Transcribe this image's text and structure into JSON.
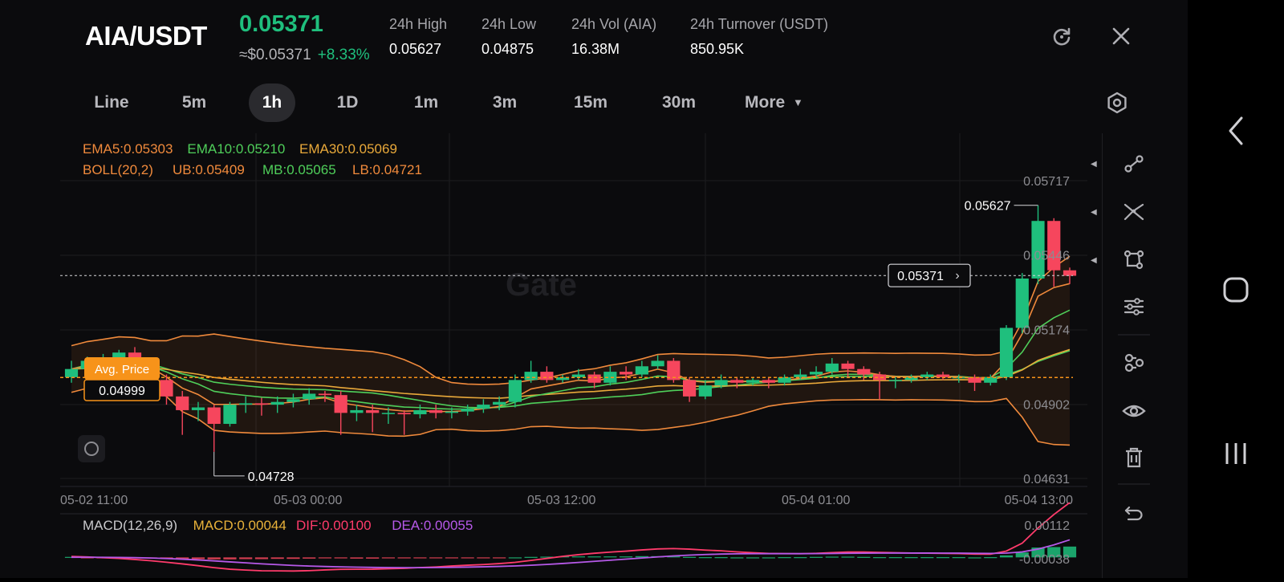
{
  "header": {
    "pair": "AIA/USDT",
    "price": "0.05371",
    "fiat_price": "≈$0.05371",
    "change": "+8.33%",
    "stats": [
      {
        "label": "24h   High",
        "value": "0.05627"
      },
      {
        "label": "24h   Low",
        "value": "0.04875"
      },
      {
        "label": "24h   Vol (AIA)",
        "value": "16.38M"
      },
      {
        "label": "24h   Turnover (USDT)",
        "value": "850.95K"
      }
    ],
    "icons": {
      "refresh": "refresh-icon",
      "close": "close-icon"
    }
  },
  "tabs": {
    "items": [
      "Line",
      "5m",
      "1h",
      "1D",
      "1m",
      "3m",
      "15m",
      "30m",
      "More"
    ],
    "active": "1h",
    "settings_icon": "hexagon-settings-icon"
  },
  "indicators": {
    "ema": [
      {
        "text": "EMA5:0.05303",
        "color": "#f08a3c"
      },
      {
        "text": "EMA10:0.05210",
        "color": "#4fcf5a"
      },
      {
        "text": "EMA30:0.05069",
        "color": "#e9a93a"
      }
    ],
    "boll": [
      {
        "text": "BOLL(20,2)",
        "color": "#f08a3c"
      },
      {
        "text": "UB:0.05409",
        "color": "#f08a3c"
      },
      {
        "text": "MB:0.05065",
        "color": "#4fcf5a"
      },
      {
        "text": "LB:0.04721",
        "color": "#f08a3c"
      }
    ],
    "macd": [
      {
        "text": "MACD(12,26,9)",
        "color": "#c9c9cc"
      },
      {
        "text": "MACD:0.00044",
        "color": "#e9b23a"
      },
      {
        "text": "DIF:0.00100",
        "color": "#ff3b6b"
      },
      {
        "text": "DEA:0.00055",
        "color": "#b659e8"
      }
    ]
  },
  "chart_data": {
    "type": "candlestick",
    "watermark": "Gate",
    "y_range": [
      0.04631,
      0.05717
    ],
    "y_ticks": [
      "0.05717",
      "0.05446",
      "0.05174",
      "0.04902",
      "0.04631"
    ],
    "x_ticks": [
      "05-02 11:00",
      "05-03 00:00",
      "05-03 12:00",
      "05-04 01:00",
      "05-04 13:00"
    ],
    "current_price": "0.05371",
    "avg_price_label": "Avg. Price",
    "avg_price": "0.04999",
    "high_marker": "0.05627",
    "low_marker": "0.04728",
    "macd_ticks": [
      "0.00112",
      "-0.00038"
    ],
    "candles": [
      [
        0.05,
        0.0503,
        0.0506,
        0.0498
      ],
      [
        0.0503,
        0.0506,
        0.05075,
        0.0501
      ],
      [
        0.0506,
        0.0507,
        0.05085,
        0.0504
      ],
      [
        0.0507,
        0.0509,
        0.051,
        0.0505
      ],
      [
        0.0509,
        0.0505,
        0.0511,
        0.0503
      ],
      [
        0.0505,
        0.0499,
        0.0507,
        0.0496
      ],
      [
        0.0499,
        0.0493,
        0.0501,
        0.049
      ],
      [
        0.0493,
        0.0488,
        0.0495,
        0.0479
      ],
      [
        0.0488,
        0.0489,
        0.0491,
        0.0484
      ],
      [
        0.0489,
        0.0483,
        0.049,
        0.04728
      ],
      [
        0.0483,
        0.049,
        0.0491,
        0.0482
      ],
      [
        0.049,
        0.04905,
        0.0493,
        0.0487
      ],
      [
        0.04905,
        0.049,
        0.04925,
        0.0486
      ],
      [
        0.049,
        0.0491,
        0.0493,
        0.0487
      ],
      [
        0.0491,
        0.0492,
        0.0494,
        0.0489
      ],
      [
        0.0492,
        0.0494,
        0.0496,
        0.049
      ],
      [
        0.0494,
        0.04935,
        0.0495,
        0.0491
      ],
      [
        0.04935,
        0.0487,
        0.0495,
        0.0479
      ],
      [
        0.0487,
        0.0488,
        0.049,
        0.0484
      ],
      [
        0.0488,
        0.0487,
        0.049,
        0.048
      ],
      [
        0.0487,
        0.0487,
        0.0489,
        0.0483
      ],
      [
        0.0487,
        0.04865,
        0.0488,
        0.0479
      ],
      [
        0.04865,
        0.0488,
        0.049,
        0.0485
      ],
      [
        0.0488,
        0.0487,
        0.049,
        0.0485
      ],
      [
        0.0487,
        0.04875,
        0.0489,
        0.0485
      ],
      [
        0.04875,
        0.04885,
        0.049,
        0.0486
      ],
      [
        0.04885,
        0.049,
        0.0492,
        0.0487
      ],
      [
        0.049,
        0.0491,
        0.0493,
        0.0488
      ],
      [
        0.0491,
        0.0499,
        0.0501,
        0.0489
      ],
      [
        0.0499,
        0.0502,
        0.0506,
        0.0498
      ],
      [
        0.0502,
        0.0499,
        0.0504,
        0.0498
      ],
      [
        0.0499,
        0.05,
        0.0501,
        0.0498
      ],
      [
        0.05,
        0.0501,
        0.0503,
        0.0499
      ],
      [
        0.0501,
        0.0498,
        0.0502,
        0.0496
      ],
      [
        0.0498,
        0.0502,
        0.0504,
        0.0497
      ],
      [
        0.0502,
        0.0501,
        0.0504,
        0.0499
      ],
      [
        0.0501,
        0.0504,
        0.0506,
        0.05
      ],
      [
        0.0504,
        0.0506,
        0.0508,
        0.0503
      ],
      [
        0.0506,
        0.0499,
        0.0507,
        0.0498
      ],
      [
        0.0499,
        0.0493,
        0.05,
        0.0491
      ],
      [
        0.0493,
        0.0497,
        0.0499,
        0.0492
      ],
      [
        0.0497,
        0.0499,
        0.0501,
        0.0496
      ],
      [
        0.0499,
        0.0498,
        0.05,
        0.0496
      ],
      [
        0.0498,
        0.0499,
        0.05,
        0.0497
      ],
      [
        0.0499,
        0.0498,
        0.05,
        0.0496
      ],
      [
        0.0498,
        0.05,
        0.0501,
        0.0497
      ],
      [
        0.05,
        0.0501,
        0.0503,
        0.0499
      ],
      [
        0.0501,
        0.0502,
        0.0504,
        0.05
      ],
      [
        0.0502,
        0.0505,
        0.0507,
        0.0501
      ],
      [
        0.0505,
        0.0503,
        0.0506,
        0.05
      ],
      [
        0.0503,
        0.0501,
        0.0504,
        0.0499
      ],
      [
        0.0501,
        0.0499,
        0.0502,
        0.0492
      ],
      [
        0.0499,
        0.0499,
        0.05,
        0.0496
      ],
      [
        0.0499,
        0.05,
        0.0501,
        0.0498
      ],
      [
        0.05,
        0.0501,
        0.0502,
        0.0499
      ],
      [
        0.0501,
        0.05,
        0.0502,
        0.0499
      ],
      [
        0.05,
        0.05,
        0.0501,
        0.0498
      ],
      [
        0.05,
        0.0498,
        0.0501,
        0.0495
      ],
      [
        0.0498,
        0.05,
        0.0501,
        0.0497
      ],
      [
        0.05,
        0.0518,
        0.0519,
        0.0499
      ],
      [
        0.0518,
        0.0536,
        0.0538,
        0.0516
      ],
      [
        0.0536,
        0.0557,
        0.05627,
        0.0534
      ],
      [
        0.0557,
        0.0539,
        0.0558,
        0.0533
      ],
      [
        0.0539,
        0.0537,
        0.054,
        0.0534
      ]
    ],
    "macd_hist": [
      2e-05,
      -1e-05,
      -2e-05,
      -2e-05,
      -3e-05,
      -4e-05,
      -5e-05,
      -6e-05,
      -7e-05,
      -8e-05,
      -8e-05,
      -7e-05,
      -7e-05,
      -6e-05,
      -6e-05,
      -5e-05,
      -4e-05,
      -4e-05,
      -5e-05,
      -5e-05,
      -4e-05,
      -4e-05,
      -3e-05,
      -3e-05,
      -2e-05,
      -2e-05,
      -2e-05,
      -1e-05,
      0.0,
      2e-05,
      3e-05,
      4e-05,
      4e-05,
      4e-05,
      4e-05,
      4e-05,
      5e-05,
      5e-05,
      4e-05,
      2e-05,
      1e-05,
      1e-05,
      0.0,
      0.0,
      0.0,
      1e-05,
      1e-05,
      2e-05,
      3e-05,
      3e-05,
      2e-05,
      1e-05,
      1e-05,
      1e-05,
      1e-05,
      1e-05,
      1e-05,
      0.0,
      1e-05,
      8e-05,
      0.0002,
      0.0004,
      0.00042,
      0.00044
    ]
  },
  "toolbar": {
    "tools": [
      "trend-line-icon",
      "cross-line-icon",
      "shape-tool-icon",
      "indicator-settings-icon",
      "link-icon",
      "visibility-icon",
      "trash-icon",
      "undo-icon"
    ]
  },
  "nav": {
    "icons": [
      "back-icon",
      "home-icon",
      "recent-apps-icon"
    ]
  },
  "colors": {
    "up": "#1fbf7d",
    "down": "#f6465d",
    "ema5": "#f08a3c",
    "ema10": "#4fcf5a",
    "ema30": "#e9a93a",
    "boll": "#f08a3c",
    "boll_mid": "#4fcf5a",
    "avg_price": "#f7931a",
    "dif": "#ff3b6b",
    "dea": "#b659e8",
    "grid": "#1c1c20"
  }
}
